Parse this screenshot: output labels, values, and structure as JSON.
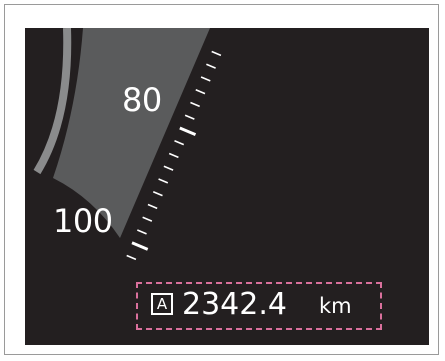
{
  "speedometer": {
    "labels": [
      "80",
      "100"
    ],
    "colors": {
      "background": "#231f20",
      "dial_fill": "#5a5b5c",
      "outer_arc": "#8a8b8c",
      "ticks": "#ffffff",
      "highlight_border": "#d9709c"
    }
  },
  "odometer": {
    "mode_indicator": "A",
    "value": "2342.4",
    "unit": "km"
  }
}
